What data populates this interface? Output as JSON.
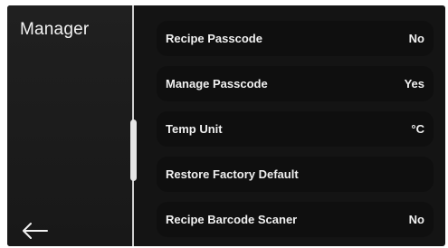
{
  "header": {
    "title": "Manager"
  },
  "settings": [
    {
      "label": "Recipe Passcode",
      "value": "No"
    },
    {
      "label": "Manage Passcode",
      "value": "Yes"
    },
    {
      "label": "Temp Unit",
      "value": "°C"
    },
    {
      "label": "Restore Factory Default",
      "value": ""
    },
    {
      "label": "Recipe Barcode Scaner",
      "value": "No"
    }
  ],
  "icons": {
    "back": "arrow-left-icon"
  }
}
